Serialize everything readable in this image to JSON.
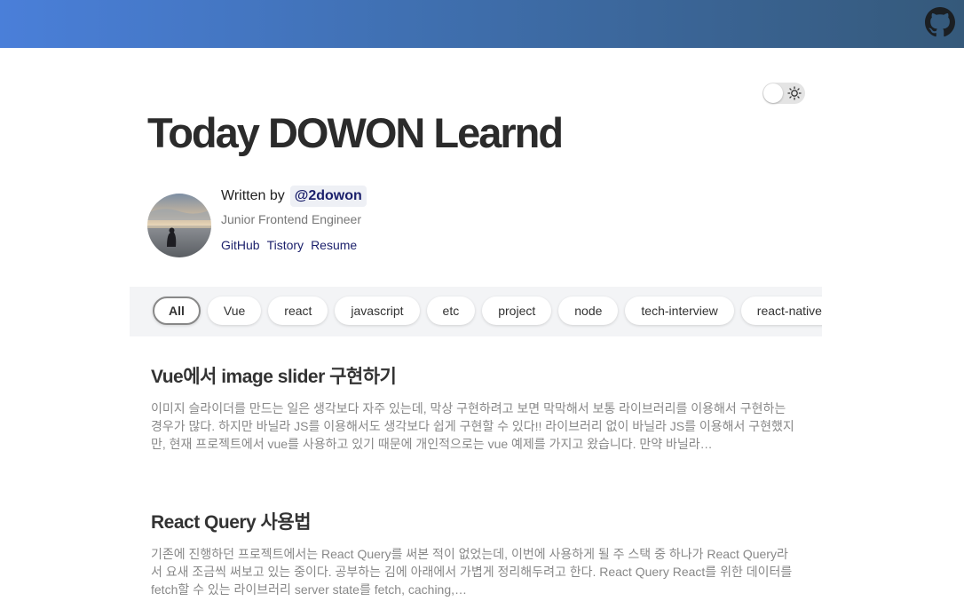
{
  "header": {
    "github_icon": "github-icon"
  },
  "theme_toggle": {
    "icon": "sun-icon",
    "state": "light"
  },
  "blog": {
    "title": "Today DOWON Learnd"
  },
  "author": {
    "written_by": "Written by",
    "handle": "@2dowon",
    "role": "Junior Frontend Engineer",
    "links": [
      "GitHub",
      "Tistory",
      "Resume"
    ]
  },
  "categories": {
    "items": [
      "All",
      "Vue",
      "react",
      "javascript",
      "etc",
      "project",
      "node",
      "tech-interview",
      "react-native"
    ],
    "selected": "All"
  },
  "posts": [
    {
      "title": "Vue에서 image slider 구현하기",
      "excerpt": "이미지 슬라이더를 만드는 일은 생각보다 자주 있는데, 막상 구현하려고 보면 막막해서 보통 라이브러리를 이용해서 구현하는 경우가 많다. 하지만 바닐라 JS를 이용해서도 생각보다 쉽게 구현할 수 있다!! 라이브러리 없이 바닐라 JS를 이용해서 구현했지만, 현재 프로젝트에서 vue를 사용하고 있기 때문에 개인적으로는 vue 예제를 가지고 왔습니다. 만약 바닐라…"
    },
    {
      "title": "React Query 사용법",
      "excerpt": "기존에 진행하던 프로젝트에서는 React Query를 써본 적이 없었는데, 이번에 사용하게 될 주 스택 중 하나가 React Query라서 요새 조금씩 써보고 있는 중이다. 공부하는 김에 아래에서 가볍게 정리해두려고 한다. React Query React를 위한 데이터를 fetch할 수 있는 라이브러리 server state를 fetch, caching,…"
    }
  ]
}
